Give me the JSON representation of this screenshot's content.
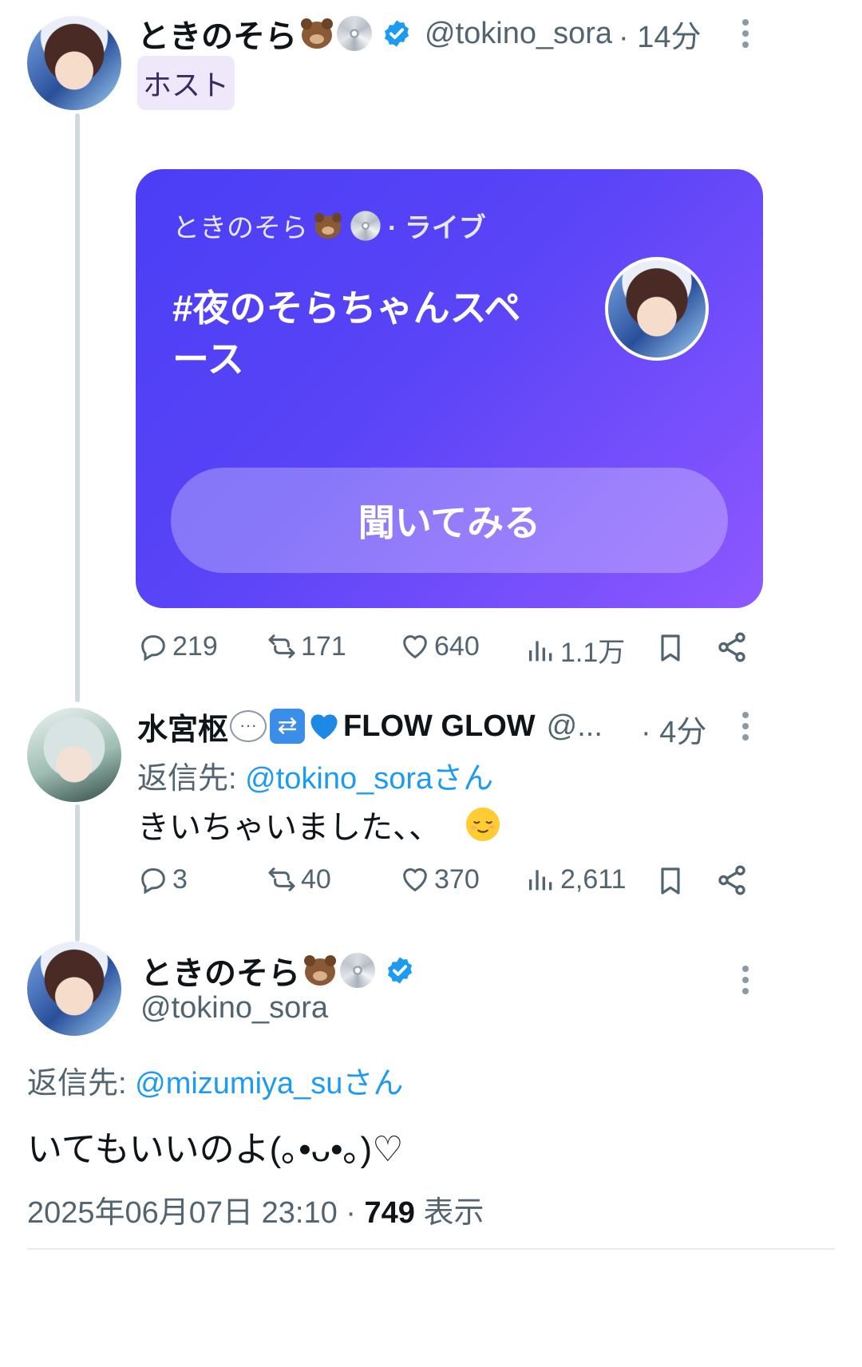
{
  "post1": {
    "display_name": "ときのそら",
    "handle": "@tokino_sora",
    "time": "· 14分",
    "host_label": "ホスト",
    "space": {
      "host_line": "ときのそら",
      "live_label": "· ライブ",
      "title": "#夜のそらちゃんスペース",
      "listen_button": "聞いてみる"
    },
    "actions": {
      "replies": "219",
      "reposts": "171",
      "likes": "640",
      "views": "1.1万"
    }
  },
  "post2": {
    "display_name": "水宮枢",
    "name_suffix": "FLOW GLOW",
    "handle_truncated": "@...",
    "time": "· 4分",
    "reply_prefix": "返信先: ",
    "reply_to": "@tokino_soraさん",
    "text": "きいちゃいました、、",
    "actions": {
      "replies": "3",
      "reposts": "40",
      "likes": "370",
      "views": "2,611"
    }
  },
  "post3": {
    "display_name": "ときのそら",
    "handle": "@tokino_sora",
    "reply_prefix": "返信先: ",
    "reply_to": "@mizumiya_suさん",
    "text": "いてもいいのよ(｡•ᴗ•｡)♡",
    "timestamp": "2025年06月07日 23:10 · ",
    "views_count": "749",
    "views_label": " 表示"
  },
  "colors": {
    "accent_link": "#1d9bf0",
    "space_gradient_start": "#4a3ef5",
    "space_gradient_end": "#8e58ff",
    "host_badge_bg": "#efe8fb"
  }
}
